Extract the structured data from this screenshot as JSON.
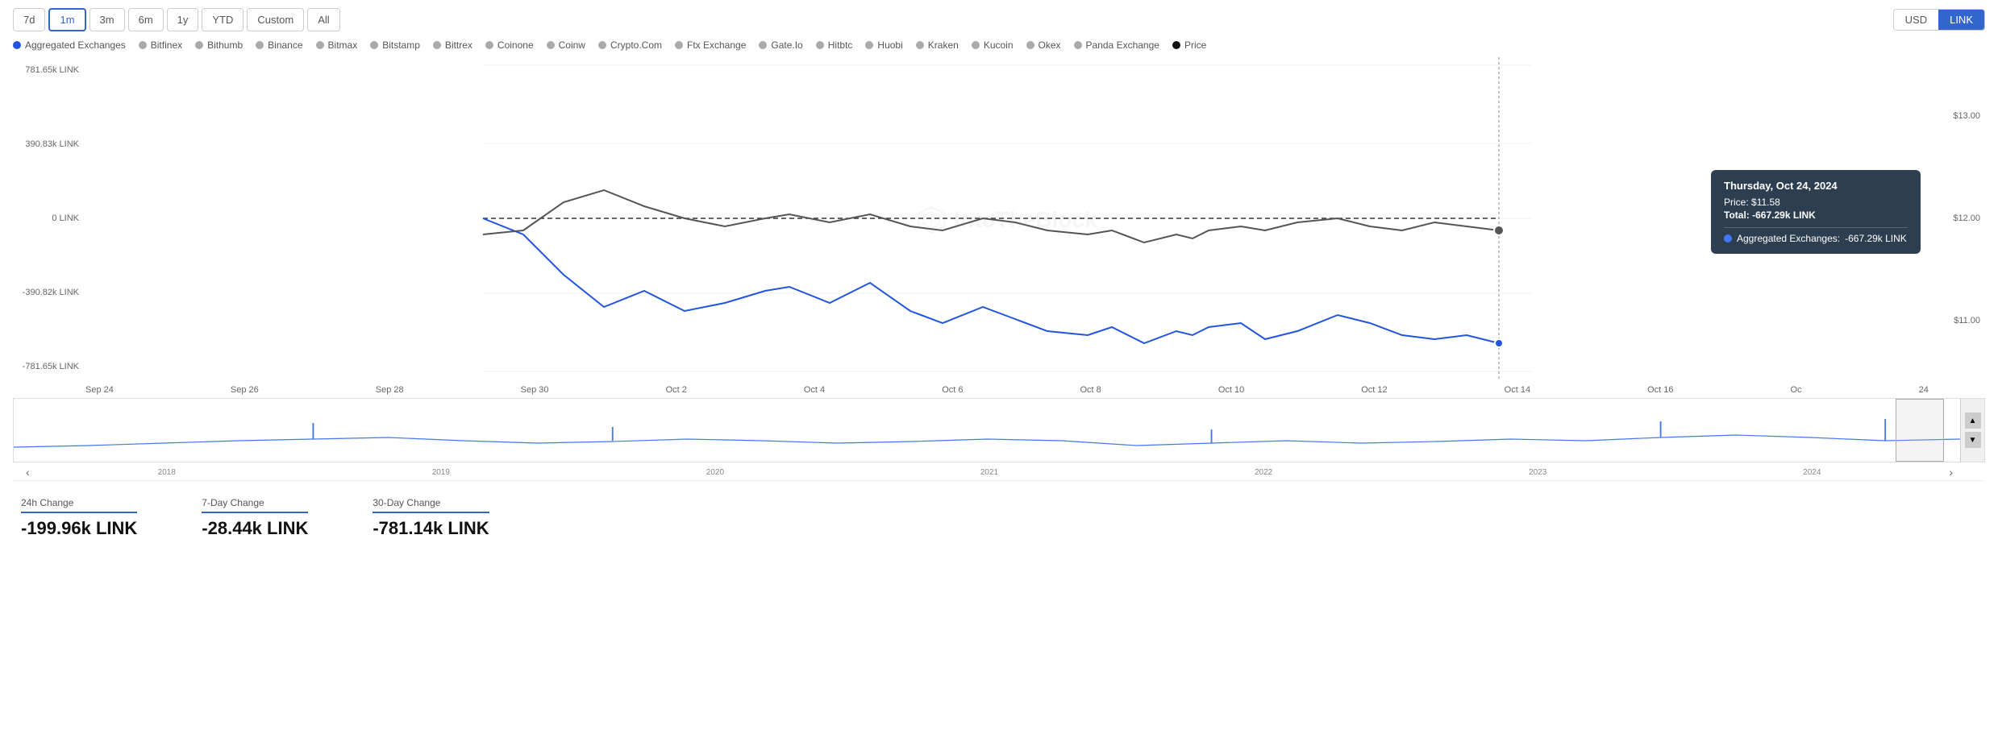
{
  "timeButtons": [
    {
      "label": "7d",
      "id": "7d",
      "active": false
    },
    {
      "label": "1m",
      "id": "1m",
      "active": true
    },
    {
      "label": "3m",
      "id": "3m",
      "active": false
    },
    {
      "label": "6m",
      "id": "6m",
      "active": false
    },
    {
      "label": "1y",
      "id": "1y",
      "active": false
    },
    {
      "label": "YTD",
      "id": "ytd",
      "active": false
    },
    {
      "label": "Custom",
      "id": "custom",
      "active": false
    },
    {
      "label": "All",
      "id": "all",
      "active": false
    }
  ],
  "currencyButtons": [
    {
      "label": "USD",
      "active": false
    },
    {
      "label": "LINK",
      "active": true
    }
  ],
  "legend": [
    {
      "label": "Aggregated Exchanges",
      "color": "#2255dd",
      "type": "filled"
    },
    {
      "label": "Bitfinex",
      "color": "#aaaaaa"
    },
    {
      "label": "Bithumb",
      "color": "#aaaaaa"
    },
    {
      "label": "Binance",
      "color": "#aaaaaa"
    },
    {
      "label": "Bitmax",
      "color": "#aaaaaa"
    },
    {
      "label": "Bitstamp",
      "color": "#aaaaaa"
    },
    {
      "label": "Bittrex",
      "color": "#aaaaaa"
    },
    {
      "label": "Coinone",
      "color": "#aaaaaa"
    },
    {
      "label": "Coinw",
      "color": "#aaaaaa"
    },
    {
      "label": "Crypto.Com",
      "color": "#aaaaaa"
    },
    {
      "label": "Ftx Exchange",
      "color": "#aaaaaa"
    },
    {
      "label": "Gate.Io",
      "color": "#aaaaaa"
    },
    {
      "label": "Hitbtc",
      "color": "#aaaaaa"
    },
    {
      "label": "Huobi",
      "color": "#aaaaaa"
    },
    {
      "label": "Kraken",
      "color": "#aaaaaa"
    },
    {
      "label": "Kucoin",
      "color": "#aaaaaa"
    },
    {
      "label": "Okex",
      "color": "#aaaaaa"
    },
    {
      "label": "Panda Exchange",
      "color": "#aaaaaa"
    },
    {
      "label": "Price",
      "color": "#111111"
    }
  ],
  "yAxisLeft": [
    "781.65k LINK",
    "390.83k LINK",
    "0 LINK",
    "-390.82k LINK",
    "-781.65k LINK"
  ],
  "yAxisRight": [
    "$13.00",
    "$12.00",
    "$11.00"
  ],
  "xAxisLabels": [
    "Sep 24",
    "Sep 26",
    "Sep 28",
    "Sep 30",
    "Oct 2",
    "Oct 4",
    "Oct 6",
    "Oct 8",
    "Oct 10",
    "Oct 12",
    "Oct 14",
    "Oct 16",
    "Oc",
    "24"
  ],
  "miniXAxisLabels": [
    "2018",
    "2019",
    "2020",
    "2021",
    "2022",
    "2023",
    "2024"
  ],
  "tooltip": {
    "date": "Thursday, Oct 24, 2024",
    "price_label": "Price:",
    "price_value": "$11.58",
    "total_label": "Total:",
    "total_value": "-667.29k LINK",
    "exchange_label": "Aggregated Exchanges:",
    "exchange_value": "-667.29k LINK"
  },
  "stats": [
    {
      "label": "24h Change",
      "value": "-199.96k LINK"
    },
    {
      "label": "7-Day Change",
      "value": "-28.44k LINK"
    },
    {
      "label": "30-Day Change",
      "value": "-781.14k LINK"
    }
  ],
  "watermark": "IntoTheBlock"
}
